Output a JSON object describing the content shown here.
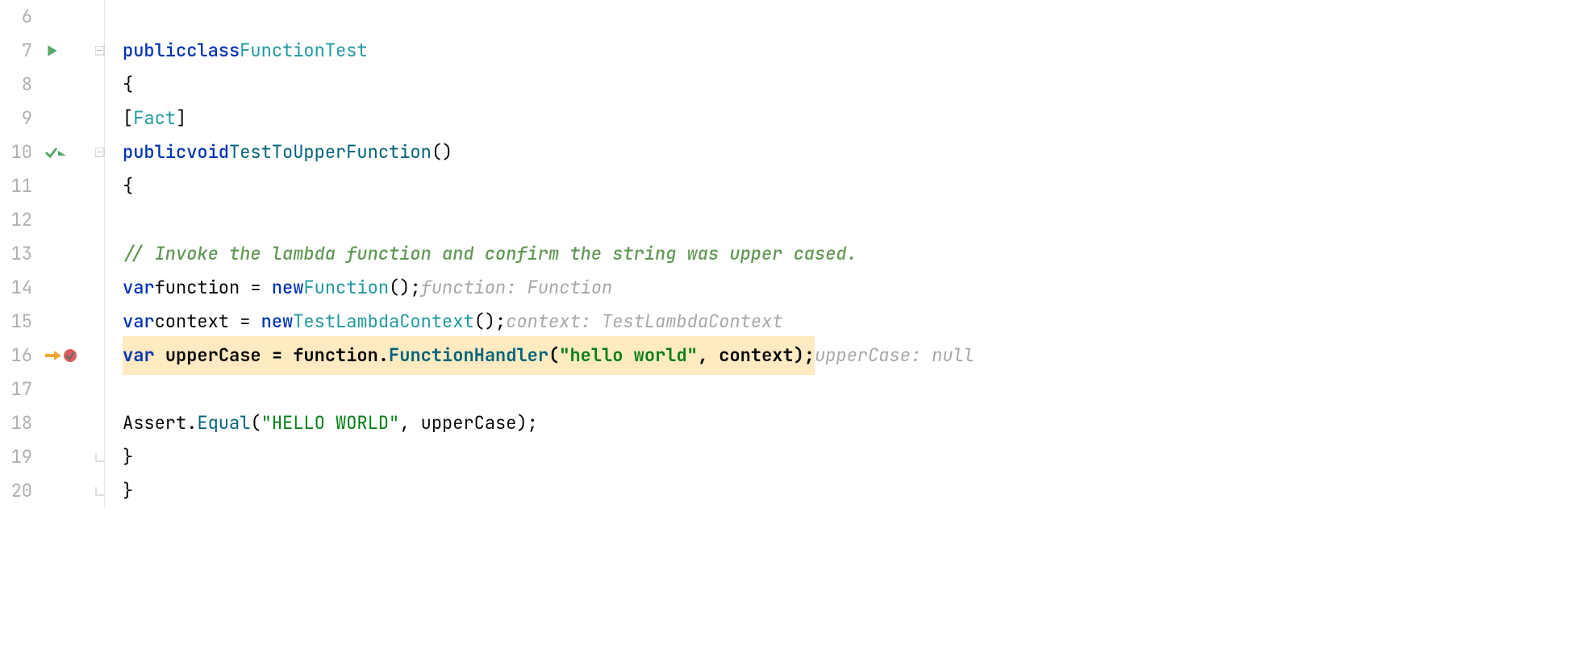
{
  "lines": {
    "6": {
      "num": "6"
    },
    "7": {
      "num": "7"
    },
    "8": {
      "num": "8"
    },
    "9": {
      "num": "9"
    },
    "10": {
      "num": "10"
    },
    "11": {
      "num": "11"
    },
    "12": {
      "num": "12"
    },
    "13": {
      "num": "13"
    },
    "14": {
      "num": "14"
    },
    "15": {
      "num": "15"
    },
    "16": {
      "num": "16"
    },
    "17": {
      "num": "17"
    },
    "18": {
      "num": "18"
    },
    "19": {
      "num": "19"
    },
    "20": {
      "num": "20"
    }
  },
  "code": {
    "l7": {
      "kw1": "public",
      "kw2": "class",
      "name": "FunctionTest"
    },
    "l8": {
      "brace": "{"
    },
    "l9": {
      "open": "[",
      "attr": "Fact",
      "close": "]"
    },
    "l10": {
      "kw1": "public",
      "kw2": "void",
      "name": "TestToUpperFunction",
      "paren": "()"
    },
    "l11": {
      "brace": "{"
    },
    "l13": {
      "comment": "// Invoke the lambda function and confirm the string was upper cased."
    },
    "l14": {
      "kw": "var",
      "ident": "function",
      "eq": " = ",
      "new": "new",
      "type": "Function",
      "end": "();",
      "hint": "function: Function"
    },
    "l15": {
      "kw": "var",
      "ident": "context",
      "eq": " = ",
      "new": "new",
      "type": "TestLambdaContext",
      "end": "();",
      "hint": "context: TestLambdaContext"
    },
    "l16": {
      "kw": "var",
      "ident": "upperCase",
      "eq": " = ",
      "obj": "function",
      "dot": ".",
      "method": "FunctionHandler",
      "open": "(",
      "str": "\"hello world\"",
      "comma": ", ",
      "arg": "context",
      "close": ");",
      "hint": "upperCase: null"
    },
    "l18": {
      "cls": "Assert",
      "dot": ".",
      "method": "Equal",
      "open": "(",
      "str": "\"HELLO WORLD\"",
      "comma": ", ",
      "arg": "upperCase",
      "close": ");"
    },
    "l19": {
      "brace": "}"
    },
    "l20": {
      "brace": "}"
    }
  }
}
